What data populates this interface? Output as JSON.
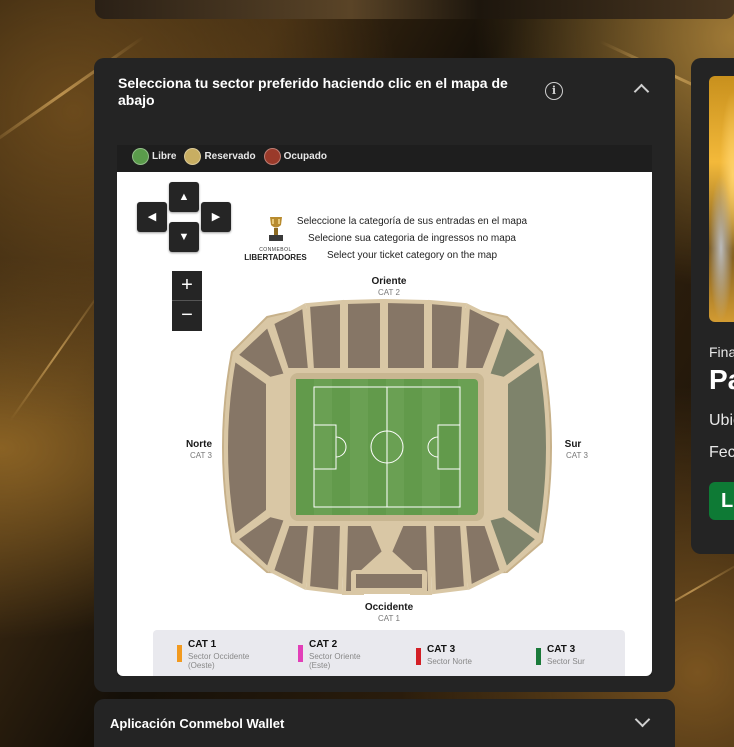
{
  "panel": {
    "title": "Selecciona tu sector preferido haciendo clic en el mapa de abajo",
    "info_icon": "info-icon",
    "collapse_icon": "chevron-up-icon"
  },
  "legend": [
    {
      "label": "Libre",
      "color": "#5a9b4b"
    },
    {
      "label": "Reservado",
      "color": "#c8ae62"
    },
    {
      "label": "Ocupado",
      "color": "#9a3a2a"
    }
  ],
  "map": {
    "nav": {
      "up": "▲",
      "down": "▼",
      "left": "◀",
      "right": "▶"
    },
    "zoom": {
      "in": "+",
      "out": "−"
    },
    "logo": {
      "small": "CONMEBOL",
      "name": "LIBERTADORES"
    },
    "instructions": [
      "Seleccione la categoría de sus entradas en el mapa",
      "Selecione sua categoria de ingressos no mapa",
      "Select your ticket category on the map"
    ],
    "sides": {
      "oriente": {
        "name": "Oriente",
        "cat": "CAT 2"
      },
      "norte": {
        "name": "Norte",
        "cat": "CAT 3"
      },
      "sur": {
        "name": "Sur",
        "cat": "CAT 3"
      },
      "occidente": {
        "name": "Occidente",
        "cat": "CAT 1"
      }
    },
    "categories": [
      {
        "label": "CAT 1",
        "desc1": "Sector Occidente",
        "desc2": "(Oeste)",
        "color": "#f29a1f"
      },
      {
        "label": "CAT 2",
        "desc1": "Sector Oriente",
        "desc2": "(Este)",
        "color": "#e23fb8"
      },
      {
        "label": "CAT 3",
        "desc1": "Sector Norte",
        "desc2": "",
        "color": "#d41f26"
      },
      {
        "label": "CAT 3",
        "desc1": "Sector Sur",
        "desc2": "",
        "color": "#1a7a3a"
      }
    ],
    "colors": {
      "sector_brown": "#867666",
      "sector_green": "#7e836b",
      "pitch": "#6aa053",
      "outline": "#d9c7a5"
    }
  },
  "wallet": {
    "title": "Aplicación Conmebol Wallet",
    "expand_icon": "chevron-down-icon"
  },
  "side_card": {
    "line1": "Fina",
    "line2": "Pa",
    "line3": "Ubic",
    "line4": "Fec",
    "button": "L"
  }
}
